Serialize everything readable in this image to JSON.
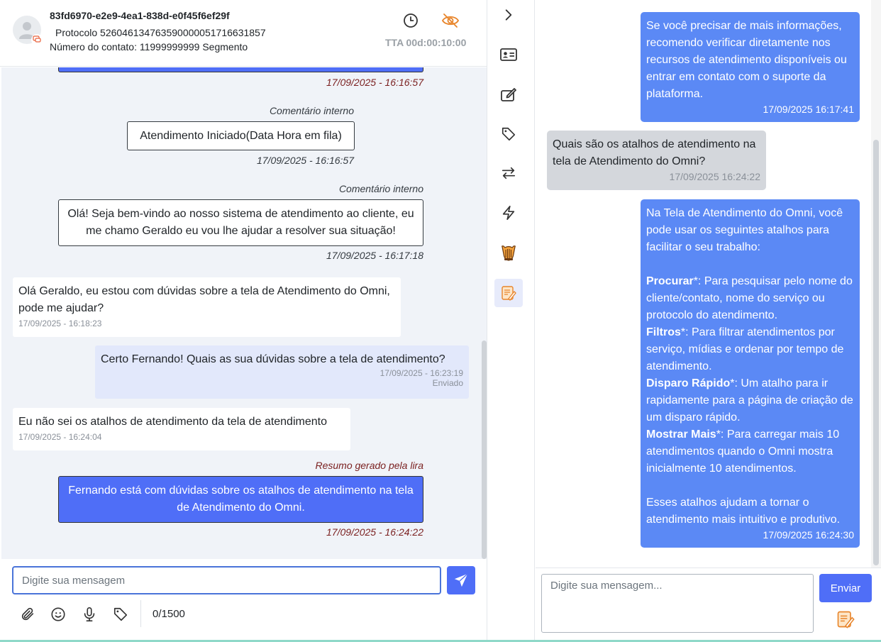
{
  "header": {
    "conversation_id": "83fd6970-e2e9-4ea1-838d-e0f45f6ef29f",
    "protocol": "Protocolo 52604613476359000005171663185​7",
    "contact": "Número do contato: 11999999999 Segmento",
    "tta": "TTA 00d:00:10:00"
  },
  "chat": {
    "top_timestamp": "17/09/2025 - 16:16:57",
    "note1": {
      "label": "Comentário interno",
      "text": "Atendimento Iniciado(Data Hora em fila)",
      "timestamp": "17/09/2025 - 16:16:57"
    },
    "note2": {
      "label": "Comentário interno",
      "text": "Olá! Seja bem-vindo ao nosso sistema de atendimento ao cliente, eu me chamo Geraldo eu vou lhe ajudar a resolver sua situação!",
      "timestamp": "17/09/2025 - 16:17:18"
    },
    "msg1": {
      "text": "Olá Geraldo, eu estou com dúvidas sobre a tela de Atendimento do Omni, pode me ajudar?",
      "time": "17/09/2025 - 16:18:23"
    },
    "msg2": {
      "text": "Certo Fernando! Quais as sua dúvidas sobre a tela de atendimento?",
      "time": "17/09/2025 - 16:23:19",
      "status": "Enviado"
    },
    "msg3": {
      "text": "Eu não sei os atalhos de atendimento da tela de atendimento",
      "time": "17/09/2025 - 16:24:04"
    },
    "summary": {
      "label": "Resumo gerado pela lira",
      "text": "Fernando está com dúvidas sobre os atalhos de atendimento na tela de Atendimento do Omni.",
      "timestamp": "17/09/2025 - 16:24:22"
    }
  },
  "composer": {
    "placeholder": "Digite sua mensagem",
    "counter": "0/1500"
  },
  "assistant": {
    "msg1": {
      "text": "Se você precisar de mais informações, recomendo verificar diretamente nos recursos de atendimento disponíveis ou entrar em contato com o suporte da plataforma.",
      "time": "17/09/2025 16:17:41"
    },
    "question": {
      "text": "Quais são os atalhos de atendimento na tela de Atendimento do Omni?",
      "time": "17/09/2025 16:24:22"
    },
    "answer": {
      "intro": "Na Tela de Atendimento do Omni, você pode usar os seguintes atalhos para facilitar o seu trabalho:",
      "items": [
        {
          "key": "Procurar",
          "desc": "*: Para pesquisar pelo nome do cliente/contato, nome do serviço ou protocolo do atendimento."
        },
        {
          "key": "Filtros",
          "desc": "*: Para filtrar atendimentos por serviço, mídias e ordenar por tempo de atendimento."
        },
        {
          "key": "Disparo Rápido",
          "desc": "*: Um atalho para ir rapidamente para a página de criação de um disparo rápido."
        },
        {
          "key": "Mostrar Mais",
          "desc": "*: Para carregar mais 10 atendimentos quando o Omni mostra inicialmente 10 atendimentos."
        }
      ],
      "outro": "Esses atalhos ajudam a tornar o atendimento mais intuitivo e produtivo.",
      "time": "17/09/2025 16:24:30"
    },
    "input_placeholder": "Digite sua mensagem...",
    "send_label": "Enviar"
  },
  "colors": {
    "accent": "#4f6ef7",
    "assistant_bubble": "#5b89f5",
    "timestamp_red": "#7a1f1f",
    "eye_icon": "#e8852b"
  },
  "icons": [
    "person-icon",
    "chat-badge-icon",
    "clock-icon",
    "eye-off-icon",
    "chevron-right-icon",
    "contact-card-icon",
    "edit-icon",
    "tag-icon",
    "transfer-icon",
    "lightning-icon",
    "lira-harp-icon",
    "lira-note-icon",
    "paperclip-icon",
    "emoji-icon",
    "microphone-icon",
    "send-icon"
  ]
}
